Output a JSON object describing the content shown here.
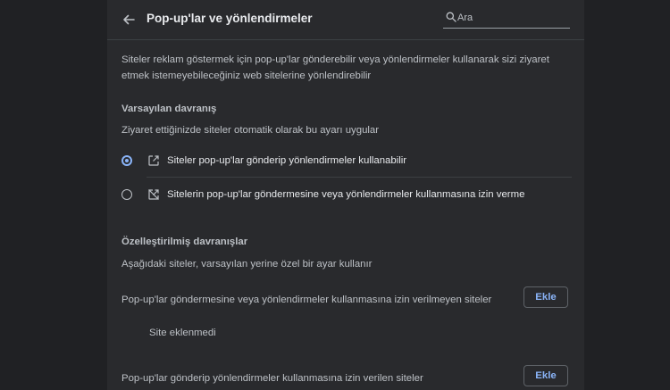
{
  "header": {
    "title": "Pop-up'lar ve yönlendirmeler",
    "back_icon": "arrow-back-icon",
    "search": {
      "placeholder": "Ara",
      "value": "",
      "icon": "search-icon"
    }
  },
  "description": "Siteler reklam göstermek için pop-up'lar gönderebilir veya yönlendirmeler kullanarak sizi ziyaret etmek istemeyebileceğiniz web sitelerine yönlendirebilir",
  "default_behavior": {
    "heading": "Varsayılan davranış",
    "subtitle": "Ziyaret ettiğinizde siteler otomatik olarak bu ayarı uygular",
    "options": [
      {
        "label": "Siteler pop-up'lar gönderip yönlendirmeler kullanabilir",
        "selected": true,
        "icon": "open-in-new-icon"
      },
      {
        "label": "Sitelerin pop-up'lar göndermesine veya yönlendirmeler kullanmasına izin verme",
        "selected": false,
        "icon": "popup-blocked-icon"
      }
    ]
  },
  "custom_behavior": {
    "heading": "Özelleştirilmiş davranışlar",
    "subtitle": "Aşağıdaki siteler, varsayılan yerine özel bir ayar kullanır",
    "blocked": {
      "label": "Pop-up'lar göndermesine veya yönlendirmeler kullanmasına izin verilmeyen siteler",
      "button": "Ekle",
      "empty": "Site eklenmedi"
    },
    "allowed": {
      "label": "Pop-up'lar gönderip yönlendirmeler kullanmasına izin verilen siteler",
      "button": "Ekle"
    }
  },
  "colors": {
    "background": "#202124",
    "panel": "#292a2d",
    "accent": "#8ab4f8",
    "text_primary": "#e8eaed",
    "text_secondary": "#bdc1c6"
  }
}
